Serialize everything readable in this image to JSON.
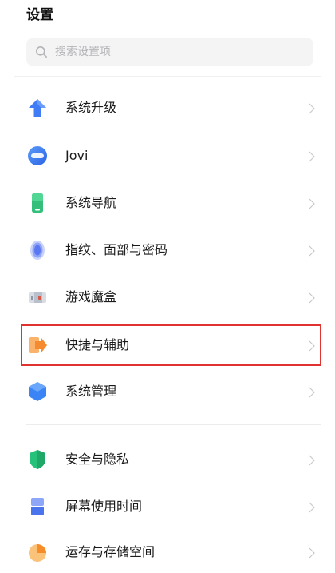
{
  "header": {
    "title": "设置"
  },
  "search": {
    "icon": "search-icon",
    "placeholder": "搜索设置项"
  },
  "settings": {
    "groups": [
      {
        "items": [
          {
            "label": "系统升级",
            "icon": "upgrade-arrow-icon",
            "accent": "#3f7cf6"
          },
          {
            "label": "Jovi",
            "icon": "jovi-icon",
            "accent": "#3a7cf3"
          },
          {
            "label": "系统导航",
            "icon": "navigation-phone-icon",
            "accent": "#3cc17a"
          },
          {
            "label": "指纹、面部与密码",
            "icon": "fingerprint-icon",
            "accent": "#5b78f2"
          },
          {
            "label": "游戏魔盒",
            "icon": "game-box-icon",
            "accent": "#d65a4a"
          },
          {
            "label": "快捷与辅助",
            "icon": "shortcut-icon",
            "accent": "#f8913b",
            "highlighted": true
          },
          {
            "label": "系统管理",
            "icon": "system-management-icon",
            "accent": "#3a84f5"
          }
        ]
      },
      {
        "items": [
          {
            "label": "安全与隐私",
            "icon": "shield-icon",
            "accent": "#27c27a"
          },
          {
            "label": "屏幕使用时间",
            "icon": "hourglass-icon",
            "accent": "#4a74ee"
          },
          {
            "label": "运存与存储空间",
            "icon": "storage-pie-icon",
            "accent": "#f7a23a"
          }
        ]
      }
    ]
  }
}
